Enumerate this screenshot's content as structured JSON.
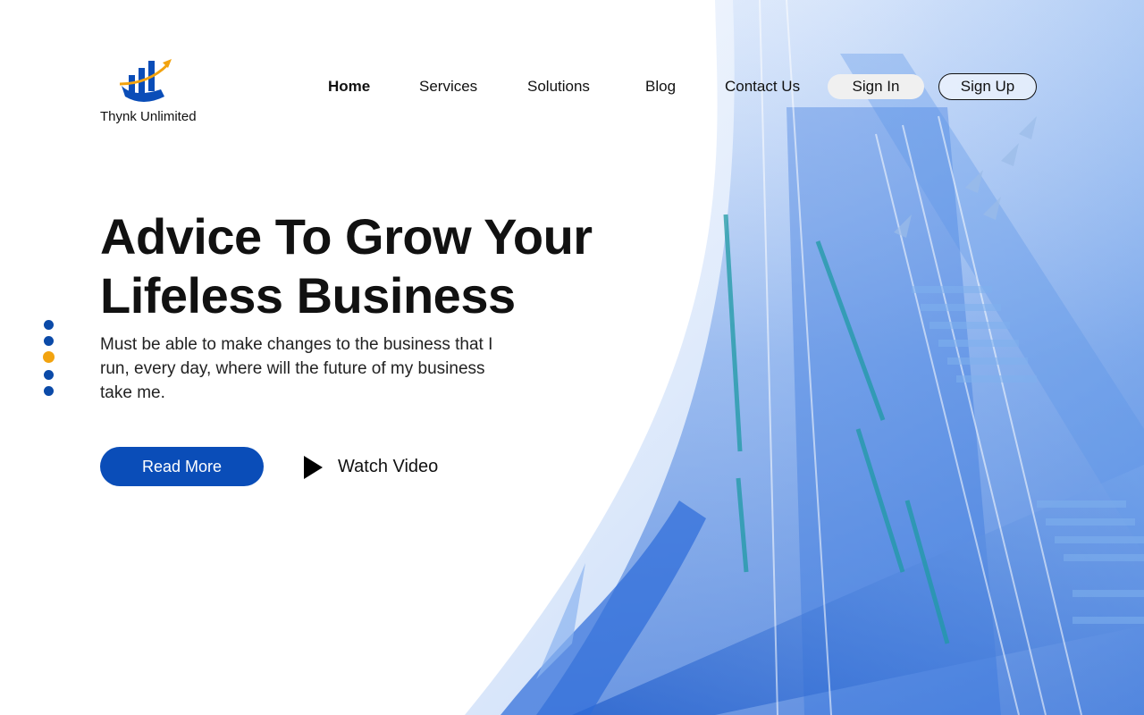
{
  "brand": {
    "name": "Thynk Unlimited",
    "logo_icon": "rising-chart-arrow-icon"
  },
  "nav": {
    "items": [
      {
        "label": "Home",
        "active": true
      },
      {
        "label": "Services",
        "active": false
      },
      {
        "label": "Solutions",
        "active": false
      },
      {
        "label": "Blog",
        "active": false
      },
      {
        "label": "Contact Us",
        "active": false
      }
    ],
    "sign_in": "Sign In",
    "sign_up": "Sign Up"
  },
  "hero": {
    "headline_line1": "Advice To Grow Your",
    "headline_line2": "Lifeless Business",
    "subtext": "Must be able to make changes to the business that I run, every day, where will the future of my business take me.",
    "primary_cta": "Read More",
    "secondary_cta": "Watch Video",
    "secondary_icon": "play-icon"
  },
  "slider": {
    "count": 5,
    "active_index": 2
  },
  "colors": {
    "brand_blue": "#0a4db8",
    "accent_orange": "#f2a30f",
    "text_dark": "#111111"
  }
}
